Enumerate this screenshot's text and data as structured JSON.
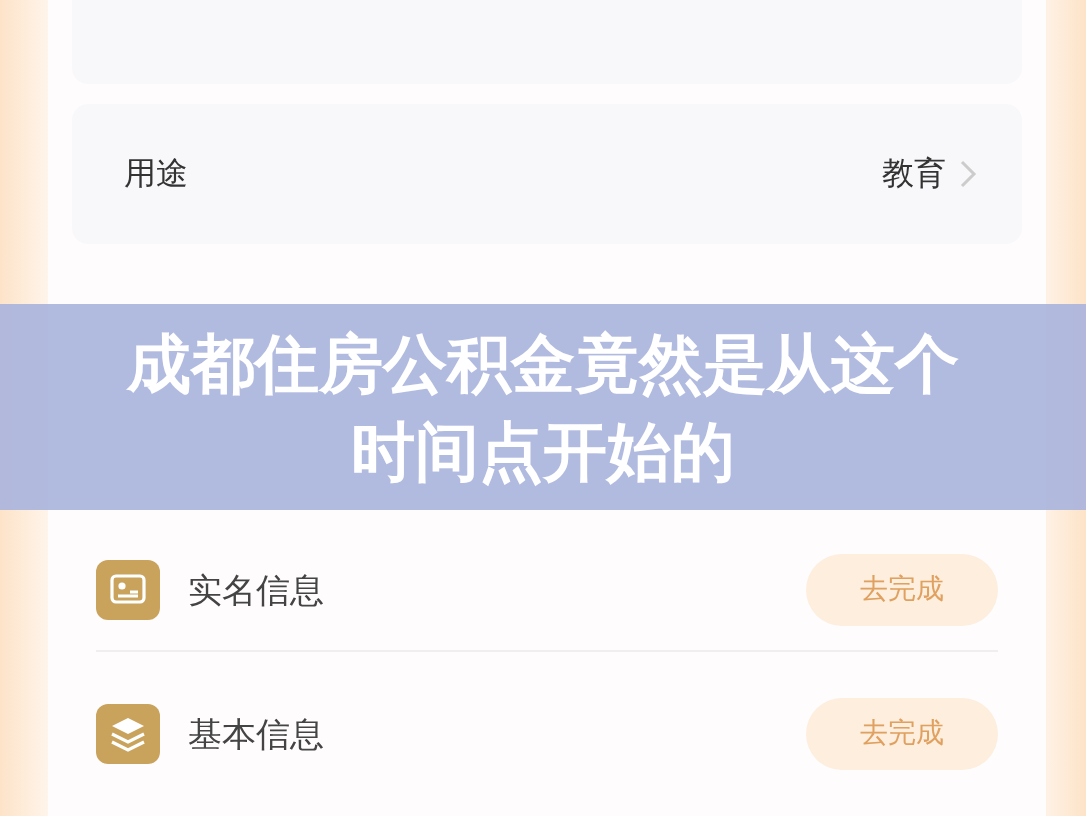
{
  "rows": [
    {
      "label": "用途",
      "value": "教育"
    }
  ],
  "tasks": [
    {
      "kind": "id-card",
      "label": "实名信息",
      "action": "去完成"
    },
    {
      "kind": "layers",
      "label": "基本信息",
      "action": "去完成"
    }
  ],
  "banner": {
    "title": "成都住房公积金竟然是从这个时间点开始的"
  }
}
